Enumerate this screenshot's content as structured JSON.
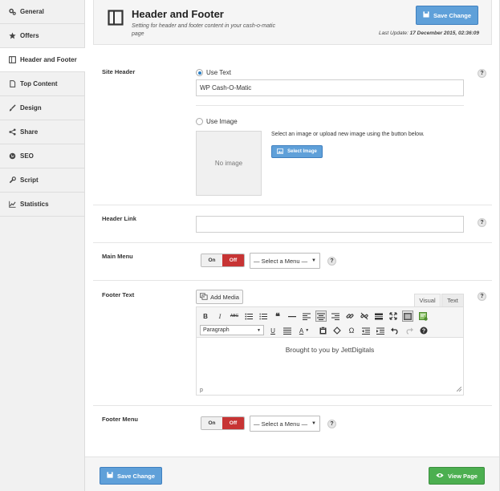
{
  "sidebar": {
    "items": [
      {
        "label": "General",
        "icon": "gears-icon",
        "active": false
      },
      {
        "label": "Offers",
        "icon": "star-icon",
        "active": false
      },
      {
        "label": "Header and Footer",
        "icon": "layout-icon",
        "active": true
      },
      {
        "label": "Top Content",
        "icon": "document-icon",
        "active": false
      },
      {
        "label": "Design",
        "icon": "brush-icon",
        "active": false
      },
      {
        "label": "Share",
        "icon": "share-icon",
        "active": false
      },
      {
        "label": "SEO",
        "icon": "globe-icon",
        "active": false
      },
      {
        "label": "Script",
        "icon": "wrench-icon",
        "active": false
      },
      {
        "label": "Statistics",
        "icon": "chart-icon",
        "active": false
      }
    ]
  },
  "header": {
    "title": "Header and Footer",
    "description": "Setting for header and footer content in your cash-o-matic page",
    "save_label": "Save Change",
    "last_update_label": "Last Update:",
    "last_update_value": "17 December 2015, 02:36:09"
  },
  "site_header": {
    "label": "Site Header",
    "use_text_label": "Use Text",
    "text_value": "WP Cash-O-Matic",
    "use_image_label": "Use Image",
    "no_image_label": "No image",
    "image_hint": "Select an image or upload new image using the button below.",
    "select_image_label": "Select Image",
    "selected": "text"
  },
  "header_link": {
    "label": "Header Link",
    "value": ""
  },
  "main_menu": {
    "label": "Main Menu",
    "on_label": "On",
    "off_label": "Off",
    "select_value": "— Select a Menu —"
  },
  "footer_text": {
    "label": "Footer Text",
    "add_media_label": "Add Media",
    "tab_visual": "Visual",
    "tab_text": "Text",
    "paragraph_label": "Paragraph",
    "content": "Brought to you by JettDigitals",
    "status_path": "p"
  },
  "footer_menu": {
    "label": "Footer Menu",
    "on_label": "On",
    "off_label": "Off",
    "select_value": "— Select a Menu —"
  },
  "footer_bar": {
    "save_label": "Save Change",
    "view_label": "View Page"
  },
  "help_symbol": "?",
  "colors": {
    "primary_blue": "#5fa0d9",
    "off_red": "#c73434",
    "view_green": "#4caf50",
    "radio_blue": "#2c7fc4"
  }
}
